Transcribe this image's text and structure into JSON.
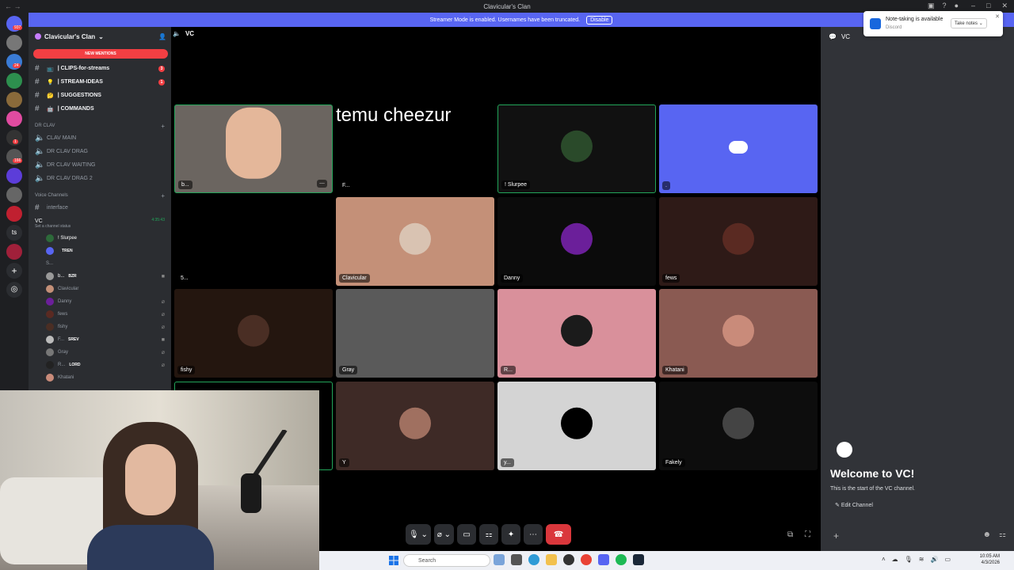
{
  "window": {
    "title": "Clavicular's Clan"
  },
  "banner": {
    "text": "Streamer Mode is enabled. Usernames have been truncated.",
    "disable_label": "Disable"
  },
  "server": {
    "name": "Clavicular's Clan",
    "new_mentions": "NEW MENTIONS"
  },
  "rail_badges": [
    "937",
    "24",
    "1",
    "166"
  ],
  "channels": [
    {
      "label": "| CLIPS-for-streams",
      "emoji": "📺",
      "unread": "3"
    },
    {
      "label": "| STREAM-IDEAS",
      "emoji": "💡",
      "unread": "1"
    },
    {
      "label": "| SUGGESTIONS",
      "emoji": "🤔",
      "unread": ""
    },
    {
      "label": "| COMMANDS",
      "emoji": "🤖",
      "unread": ""
    }
  ],
  "category_drclav": {
    "label": "DR CLAV"
  },
  "drclav_channels": [
    "CLAV MAIN",
    "DR CLAV DRAG",
    "DR CLAV WAITING",
    "DR CLAV DRAG 2"
  ],
  "category_voice": {
    "label": "Voice Channels"
  },
  "interface_channel": "interface",
  "vc": {
    "name": "VC",
    "status": "Set a channel status",
    "time": "4:35:43"
  },
  "members": [
    {
      "name": "! Slurpee",
      "tag": ""
    },
    {
      "name": "",
      "tag": "TREN"
    },
    {
      "name": "S...",
      "tag": ""
    },
    {
      "name": "b...",
      "tag": "BZR"
    },
    {
      "name": "Clavicular",
      "tag": ""
    },
    {
      "name": "Danny",
      "tag": ""
    },
    {
      "name": "fews",
      "tag": ""
    },
    {
      "name": "fishy",
      "tag": ""
    },
    {
      "name": "F...",
      "tag": "SREV"
    },
    {
      "name": "Gray",
      "tag": ""
    },
    {
      "name": "R...",
      "tag": "LORD"
    },
    {
      "name": "Khatani",
      "tag": ""
    }
  ],
  "call": {
    "header": "VC",
    "floating_text": "temu cheezur",
    "tiles": [
      {
        "label": "b...",
        "bg": "#6b6560",
        "avatar": "#e4b79a"
      },
      {
        "label": "F...",
        "bg": "#000000",
        "avatar": ""
      },
      {
        "label": "! Slurpee",
        "bg": "#111111",
        "avatar": "#2a4a2a"
      },
      {
        "label": ".",
        "bg": "#5865f2",
        "avatar": ""
      },
      {
        "label": "5...",
        "bg": "#000000",
        "avatar": ""
      },
      {
        "label": "Clavicular",
        "bg": "#c49078",
        "avatar": "#d9c3b2"
      },
      {
        "label": "Danny",
        "bg": "#0b0b0b",
        "avatar": "#6b1f9a"
      },
      {
        "label": "fews",
        "bg": "#2e1a17",
        "avatar": "#5a2a22"
      },
      {
        "label": "fishy",
        "bg": "#24160f",
        "avatar": "#4a2e24"
      },
      {
        "label": "Gray",
        "bg": "#5a5a5a",
        "avatar": ""
      },
      {
        "label": "R...",
        "bg": "#d9909b",
        "avatar": "#1b1b1b"
      },
      {
        "label": "Khatani",
        "bg": "#8a5a52",
        "avatar": "#c98b7a"
      },
      {
        "label": "",
        "bg": "#000000",
        "avatar": ""
      },
      {
        "label": "Y",
        "bg": "#3e2a26",
        "avatar": "#a07060"
      },
      {
        "label": "y...",
        "bg": "#d4d4d4",
        "avatar": "#000000"
      },
      {
        "label": "Fakely",
        "bg": "#0d0d0d",
        "avatar": "#444444"
      }
    ]
  },
  "right_panel": {
    "header": "VC",
    "welcome_title": "Welcome to VC!",
    "welcome_sub": "This is the start of the VC channel.",
    "edit_label": "Edit Channel"
  },
  "toast": {
    "title": "Note-taking is available",
    "source": "Discord",
    "button": "Take notes"
  },
  "taskbar": {
    "search_placeholder": "Search",
    "time": "10:05 AM",
    "date": "4/3/2026"
  },
  "colors": {
    "blurple": "#5865f2",
    "red": "#f23f43",
    "green": "#23a55a"
  }
}
